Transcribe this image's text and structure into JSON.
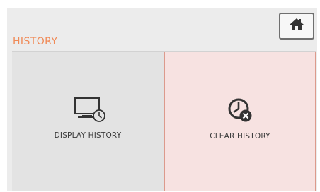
{
  "header": {
    "title": "HISTORY",
    "title_color": "#f08a57",
    "home_icon": "home-icon"
  },
  "tiles": [
    {
      "label": "DISPLAY HISTORY",
      "icon": "monitor-clock-icon",
      "selected": false
    },
    {
      "label": "CLEAR HISTORY",
      "icon": "clock-clear-icon",
      "selected": true
    }
  ],
  "colors": {
    "selected_tile_bg": "#f7e2e1",
    "selected_tile_border": "#dc9a8c",
    "tile_bg": "#e3e3e3",
    "icon": "#333333"
  }
}
